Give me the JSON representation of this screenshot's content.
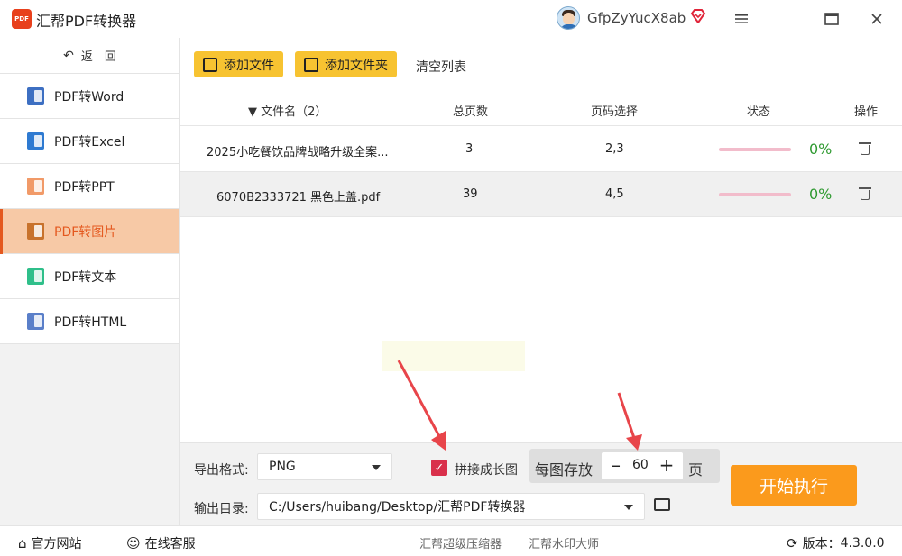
{
  "app": {
    "title": "汇帮PDF转换器",
    "logo_text": "PDF",
    "username": "GfpZyYucX8ab",
    "accent": "#e4581e"
  },
  "window_controls": {
    "menu": "≡",
    "maximize": "▭",
    "close": "×"
  },
  "sidebar": {
    "back_label": "返　回",
    "items": [
      {
        "label": "PDF转Word",
        "icon": "word-icon"
      },
      {
        "label": "PDF转Excel",
        "icon": "excel-icon"
      },
      {
        "label": "PDF转PPT",
        "icon": "ppt-icon"
      },
      {
        "label": "PDF转图片",
        "icon": "image-icon",
        "active": true
      },
      {
        "label": "PDF转文本",
        "icon": "text-icon"
      },
      {
        "label": "PDF转HTML",
        "icon": "html-icon"
      }
    ]
  },
  "toolbar": {
    "add_file": "添加文件",
    "add_folder": "添加文件夹",
    "clear_list": "清空列表"
  },
  "table": {
    "headers": {
      "filename": "文件名（2）",
      "pages": "总页数",
      "page_select": "页码选择",
      "status": "状态",
      "actions": "操作"
    },
    "rows": [
      {
        "filename": "2025小吃餐饮品牌战略升级全案...",
        "pages": "3",
        "page_select": "2,3",
        "progress": "0%"
      },
      {
        "filename": "6070B2333721 黑色上盖.pdf",
        "pages": "39",
        "page_select": "4,5",
        "progress": "0%"
      }
    ]
  },
  "options": {
    "format_label": "导出格式:",
    "format_value": "PNG",
    "stitch_label": "拼接成长图",
    "stitch_checked": true,
    "per_image_label": "每图存放",
    "per_image_value": "60",
    "per_image_unit": "页",
    "output_label": "输出目录:",
    "output_value": "C:/Users/huibang/Desktop/汇帮PDF转换器",
    "start_label": "开始执行"
  },
  "statusbar": {
    "website": "官方网站",
    "support": "在线客服",
    "link1": "汇帮超级压缩器",
    "link2": "汇帮水印大师",
    "version_label": "版本：",
    "version": "4.3.0.0"
  }
}
